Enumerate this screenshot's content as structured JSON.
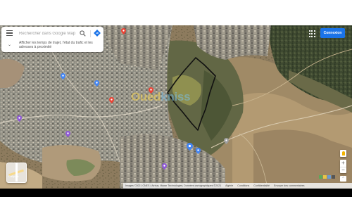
{
  "search": {
    "placeholder": "Rechercher dans Google Maps",
    "hint": "Afficher les temps de trajet, l'état du trafic et les adresses à proximité"
  },
  "header": {
    "signin_label": "Connexion"
  },
  "layers": {
    "label": "Calques"
  },
  "watermark": {
    "part1": "Oued",
    "part2": "kniss"
  },
  "footer": {
    "attribution": "Images ©2021 CNES / Airbus, Maxar Technologies, Données cartographiques ©2021",
    "country": "Algérie",
    "terms": "Conditions",
    "privacy": "Confidentialité",
    "feedback": "Envoyer des commentaires"
  },
  "icons": {
    "search": "search-icon",
    "directions": "directions-icon",
    "menu": "menu-icon",
    "apps": "apps-grid-icon",
    "pegman": "street-view-icon"
  },
  "colors": {
    "accent": "#1a73e8",
    "boundary": "#111111",
    "pin_red": "#ea4335",
    "pin_blue": "#4285f4",
    "pin_purple": "#8e58d6"
  }
}
